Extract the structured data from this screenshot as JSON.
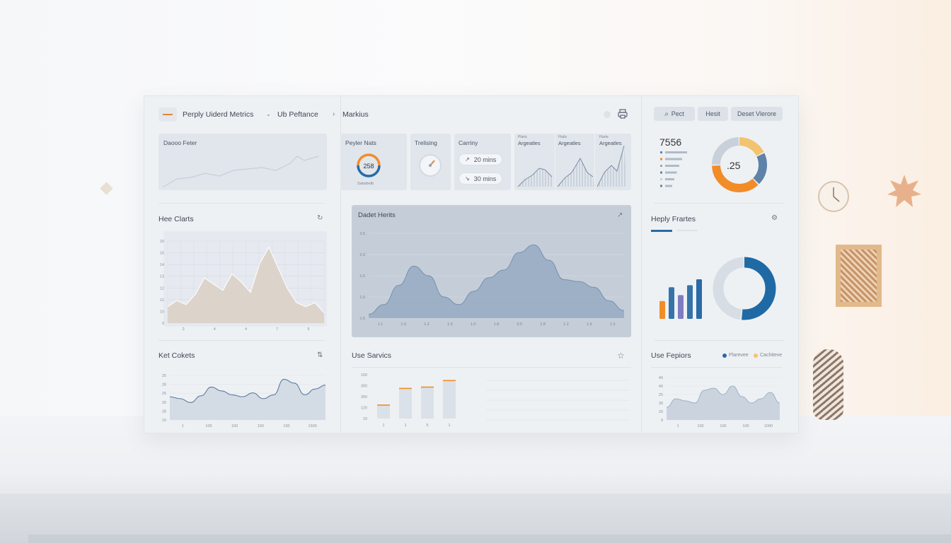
{
  "header": {
    "menu_icon": "menu-line-icon",
    "title": "Perply Uiderd Metrics",
    "nav_item_1": "Ub Peftance",
    "nav_item_2": "Markius",
    "right_pills": [
      "Pect",
      "Hesit",
      "Deset Vlerore"
    ]
  },
  "top_row": {
    "panel1_title": "Daooo Feter",
    "panel2_title": "Peyler Nats",
    "gauge_value": "258",
    "gauge_caption": "Sabsbelb",
    "panel3_title": "Trelising",
    "panel4_title": "Carriny",
    "chip1": "20 mins",
    "chip2": "30 mins",
    "mini_titles": [
      "Argeatles",
      "Argeatles",
      "Argeatles"
    ],
    "mini_subtitles": [
      "Plarts",
      "Flatis",
      "Flarte"
    ]
  },
  "right_top": {
    "big_number": "7556",
    "donut_value": ".25",
    "bars": [
      0.62,
      0.48,
      0.4,
      0.33,
      0.26,
      0.2
    ],
    "donut_segments": [
      {
        "value": 18,
        "color": "#f2c470"
      },
      {
        "value": 20,
        "color": "#5f82a8"
      },
      {
        "value": 37,
        "color": "#f28c28"
      },
      {
        "value": 25,
        "color": "#c8d0d9"
      }
    ]
  },
  "mid_left": {
    "title": "Hee Clarts",
    "y_ticks": [
      "20",
      "15",
      "14",
      "13",
      "12",
      "12",
      "10",
      "0"
    ],
    "x_ticks": [
      "3",
      "4",
      "4",
      "7",
      "9"
    ],
    "values": [
      16,
      22,
      18,
      28,
      44,
      38,
      32,
      48,
      40,
      30,
      58,
      74,
      54,
      34,
      20,
      16,
      20,
      10
    ]
  },
  "mid_center": {
    "title": "Dadet Herits",
    "y_ticks": [
      "2.5",
      "2.0",
      "1.5",
      "1.0",
      "1.5"
    ],
    "x_ticks": [
      "1.1",
      "1.0",
      "1.2",
      "1.0",
      "1.0",
      "1.8",
      "0.5",
      "1.8",
      "1.2",
      "1.9",
      "1.3"
    ],
    "values": [
      0.1,
      0.35,
      0.85,
      1.35,
      1.1,
      0.55,
      0.35,
      0.7,
      1.05,
      1.25,
      1.7,
      1.9,
      1.5,
      1.0,
      0.95,
      0.8,
      0.45,
      0.2
    ]
  },
  "mid_right": {
    "title": "Heply Frartes",
    "bars": [
      {
        "value": 0.45,
        "color": "#f28c28"
      },
      {
        "value": 0.8,
        "color": "#3673a8"
      },
      {
        "value": 0.6,
        "color": "#7e7cc2"
      },
      {
        "value": 0.85,
        "color": "#3673a8"
      },
      {
        "value": 1.0,
        "color": "#2a6aa6"
      }
    ],
    "donut_primary": 0.52
  },
  "bottom_left": {
    "title": "Ket Cokets",
    "y_ticks": [
      "25",
      "28",
      "25",
      "20",
      "28",
      "10"
    ],
    "x_ticks": [
      "1",
      "100",
      "100",
      "100",
      "100",
      "1500"
    ],
    "values": [
      2.4,
      2.2,
      1.8,
      2.5,
      3.4,
      3.0,
      2.6,
      2.4,
      2.8,
      2.2,
      2.6,
      4.2,
      3.8,
      2.6,
      3.2,
      3.6
    ]
  },
  "bottom_center": {
    "title": "Use Sarvics",
    "y_ticks": [
      "100",
      "300",
      "300",
      "120",
      "10"
    ],
    "x_ticks": [
      "1",
      "1",
      "5",
      "1"
    ],
    "bars": [
      0.32,
      0.7,
      0.73,
      0.88
    ]
  },
  "bottom_right": {
    "title": "Use Fepiors",
    "legend": [
      "Plarevee",
      "Cachiteve"
    ],
    "legend_colors": [
      "#2a6aa6",
      "#f2c470"
    ],
    "y_ticks": [
      "40",
      "40",
      "25",
      "30",
      "20",
      "0"
    ],
    "x_ticks": [
      "1",
      "100",
      "100",
      "100",
      "1000"
    ],
    "values": [
      1.2,
      2.0,
      1.8,
      1.6,
      2.8,
      3.0,
      2.4,
      3.2,
      2.2,
      1.6,
      2.0,
      2.6,
      1.6
    ]
  }
}
